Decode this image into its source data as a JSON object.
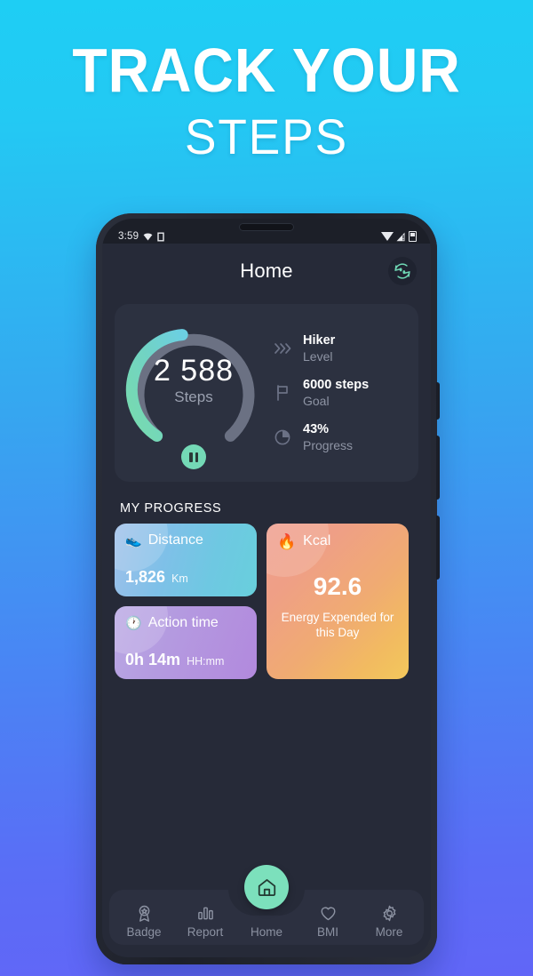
{
  "promo": {
    "headline_line1": "TRACK YOUR",
    "headline_line2": "STEPS",
    "background_top_color": "#1ecef4",
    "background_bottom_color": "#6166f7"
  },
  "status_bar": {
    "time": "3:59",
    "icons": [
      "wifi-icon",
      "sim-icon",
      "data-triangle-icon",
      "signal-alert-icon",
      "battery-icon"
    ]
  },
  "app_bar": {
    "title": "Home",
    "reset_icon": "reset-steps-icon"
  },
  "summary": {
    "ring": {
      "steps_value": "2 588",
      "steps_label": "Steps",
      "progress_percent": 43,
      "track_color": "#6b7183",
      "progress_color_start": "#6fd2e0",
      "progress_color_end": "#76d9ae",
      "pause_button_label": "pause"
    },
    "stats": [
      {
        "icon": "chevrons-right-icon",
        "value": "Hiker",
        "label": "Level"
      },
      {
        "icon": "flag-icon",
        "value": "6000 steps",
        "label": "Goal"
      },
      {
        "icon": "pie-chart-icon",
        "value": "43%",
        "label": "Progress"
      }
    ]
  },
  "my_progress": {
    "section_title": "MY PROGRESS",
    "distance": {
      "icon": "running-shoe-icon",
      "title": "Distance",
      "value": "1,826",
      "unit": "Km",
      "color_start": "#9fc0ea",
      "color_end": "#68cfdc"
    },
    "action_time": {
      "icon": "clock-icon",
      "title": "Action time",
      "value": "0h 14m",
      "unit": "HH:mm",
      "color_start": "#b9a8e4",
      "color_end": "#b289dd"
    },
    "kcal": {
      "icon": "flame-icon",
      "title": "Kcal",
      "value": "92.6",
      "description": "Energy Expended for this Day",
      "color_start": "#ef9e8e",
      "color_end": "#f3c85c"
    }
  },
  "bottom_nav": {
    "items": [
      {
        "icon": "badge-icon",
        "label": "Badge",
        "active": false
      },
      {
        "icon": "report-icon",
        "label": "Report",
        "active": false
      },
      {
        "icon": "home-icon",
        "label": "Home",
        "active": true
      },
      {
        "icon": "heart-icon",
        "label": "BMI",
        "active": false
      },
      {
        "icon": "gear-icon",
        "label": "More",
        "active": false
      }
    ],
    "fab_icon": "home-icon",
    "fab_color": "#7ce0bc"
  }
}
